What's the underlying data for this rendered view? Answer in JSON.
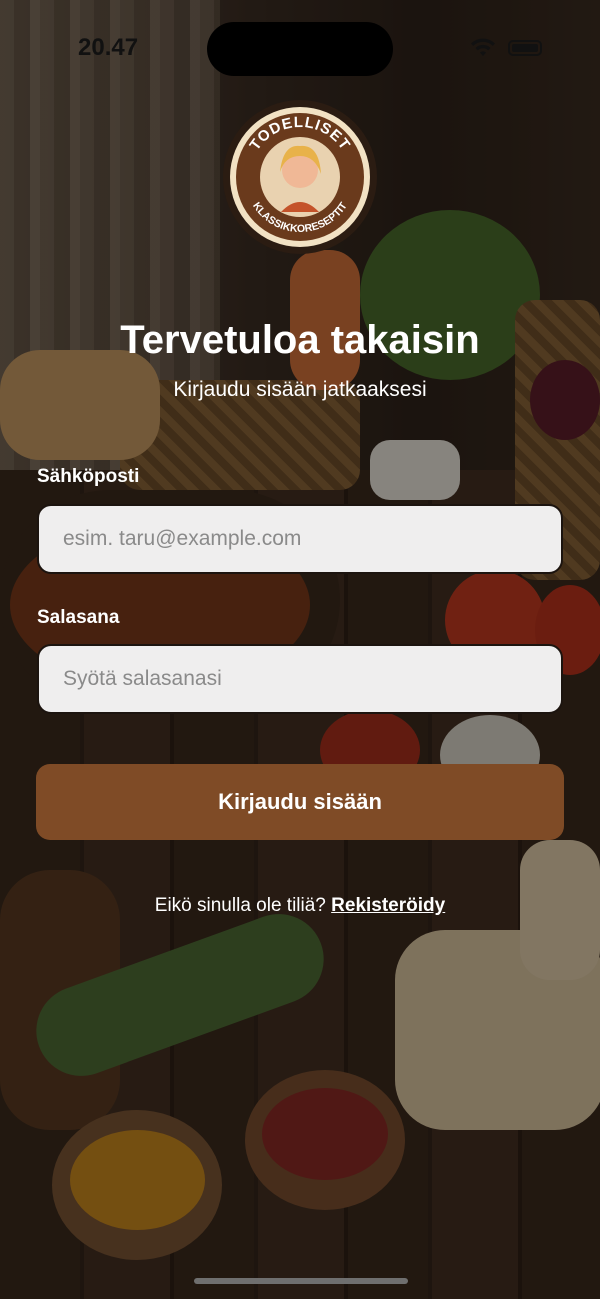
{
  "status_bar": {
    "time": "20.47"
  },
  "logo": {
    "line1": "TODELLISET",
    "line2": "KLASSIKKORESEPTIT"
  },
  "header": {
    "title": "Tervetuloa takaisin",
    "subtitle": "Kirjaudu sisään jatkaaksesi"
  },
  "form": {
    "email_label": "Sähköposti",
    "email_placeholder": "esim. taru@example.com",
    "email_value": "",
    "password_label": "Salasana",
    "password_placeholder": "Syötä salasanasi",
    "password_value": "",
    "submit_label": "Kirjaudu sisään"
  },
  "footer": {
    "prompt": "Eikö sinulla ole tiliä?",
    "register_link": "Rekisteröidy"
  },
  "colors": {
    "accent": "#7f4b26",
    "field_bg": "#efeeee"
  }
}
